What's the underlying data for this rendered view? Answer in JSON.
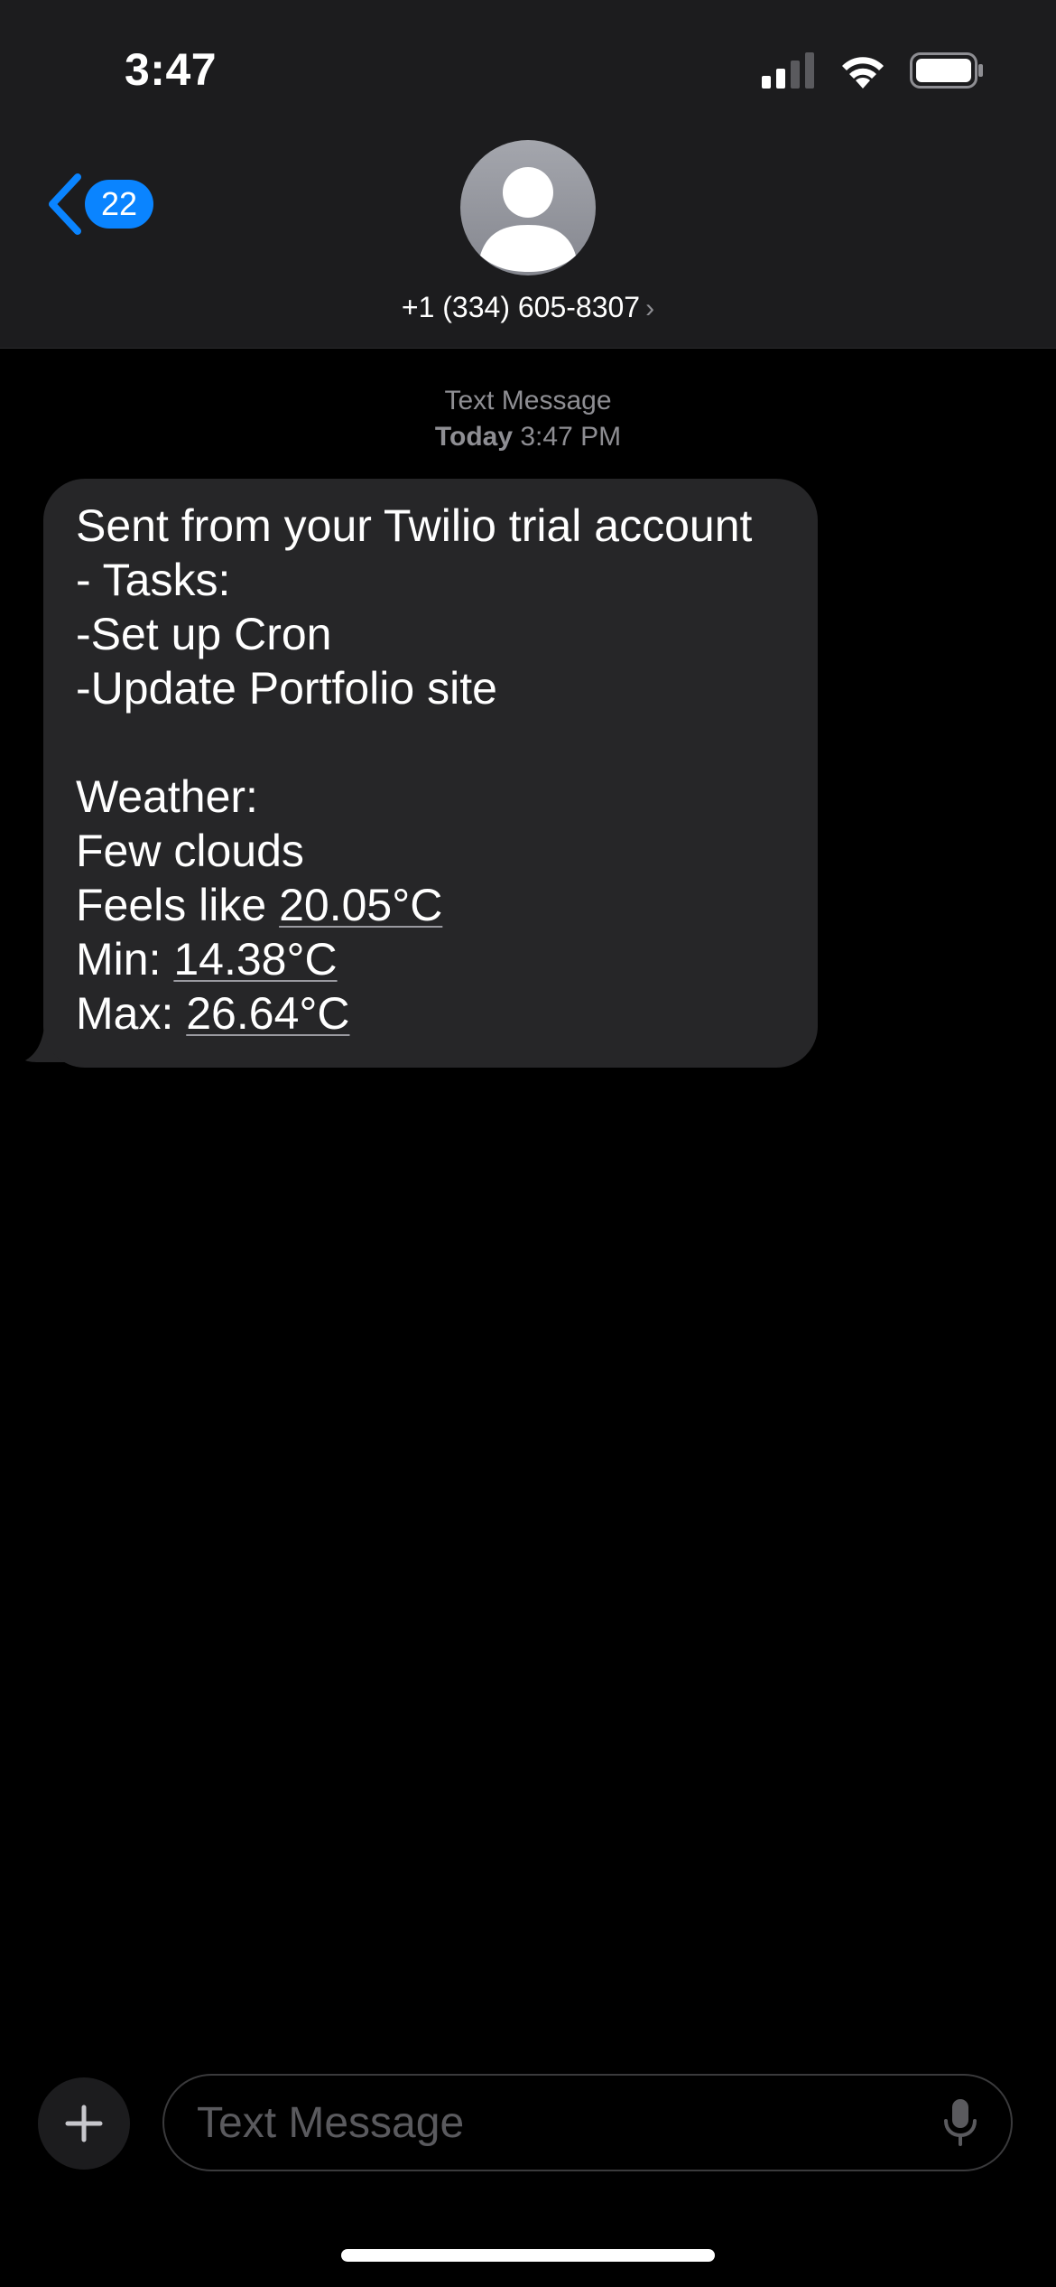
{
  "status_bar": {
    "time": "3:47",
    "icons": [
      "cellular-signal-icon",
      "wifi-icon",
      "battery-icon"
    ]
  },
  "nav": {
    "back_badge": "22",
    "contact": "+1 (334) 605-8307",
    "contact_chevron": "›"
  },
  "thread": {
    "service_label": "Text Message",
    "date_label": "Today",
    "time_label": "3:47 PM"
  },
  "message": {
    "lines": [
      {
        "text": "Sent from your Twilio trial account"
      },
      {
        "text": "- Tasks:"
      },
      {
        "text": "-Set up Cron"
      },
      {
        "text": "-Update Portfolio site"
      },
      {
        "text": ""
      },
      {
        "text": "Weather:"
      },
      {
        "text": "Few clouds"
      },
      {
        "prefix": "Feels like ",
        "link": "20.05°C"
      },
      {
        "prefix": "Min: ",
        "link": "14.38°C"
      },
      {
        "prefix": "Max: ",
        "link": "26.64°C"
      }
    ]
  },
  "composer": {
    "placeholder": "Text Message",
    "plus_icon": "plus-icon",
    "mic_icon": "microphone-icon"
  },
  "colors": {
    "header_bg": "#1c1c1e",
    "bubble_bg": "#262628",
    "accent": "#0a84ff",
    "secondary_text": "#8e8e93"
  }
}
